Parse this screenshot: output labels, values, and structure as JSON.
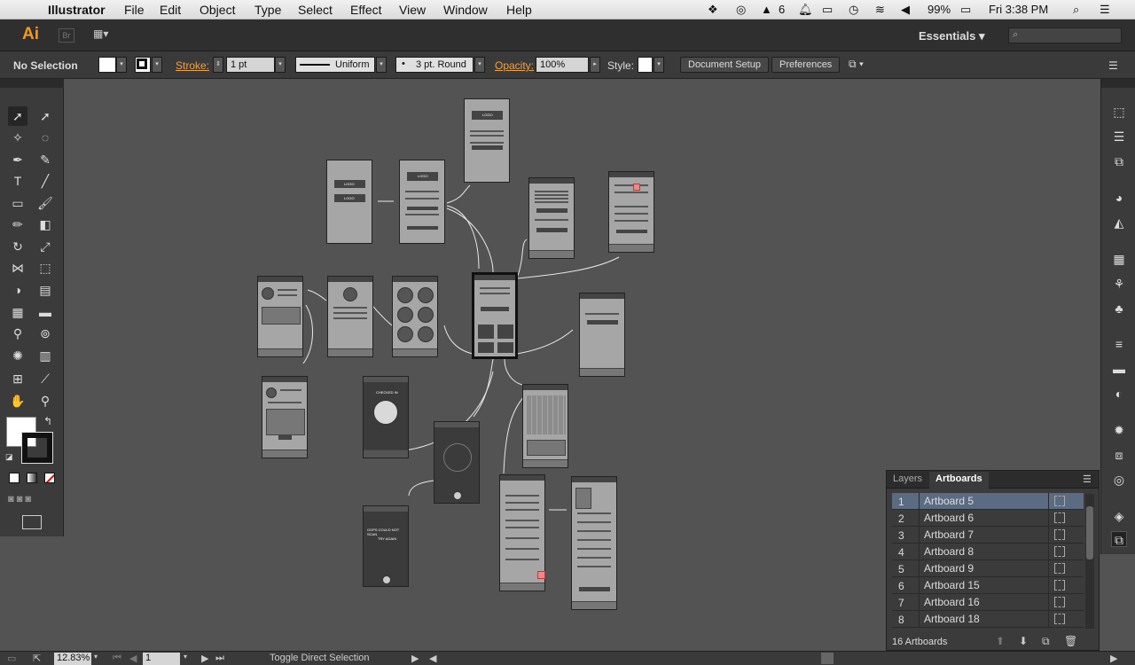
{
  "menubar": {
    "app": "Illustrator",
    "items": [
      "File",
      "Edit",
      "Object",
      "Type",
      "Select",
      "Effect",
      "View",
      "Window",
      "Help"
    ],
    "status": {
      "badge": "6",
      "battery": "99%",
      "clock": "Fri 3:38 PM"
    }
  },
  "appbar": {
    "logo": "Ai",
    "br": "Br",
    "workspace": "Essentials"
  },
  "control": {
    "selection": "No Selection",
    "stroke_label": "Stroke:",
    "stroke_value": "1 pt",
    "profile": "Uniform",
    "brush": "3 pt. Round",
    "opacity_label": "Opacity:",
    "opacity_value": "100%",
    "style_label": "Style:",
    "doc_setup": "Document Setup",
    "preferences": "Preferences"
  },
  "panel": {
    "tab_layers": "Layers",
    "tab_artboards": "Artboards",
    "rows": [
      {
        "num": "1",
        "name": "Artboard 5"
      },
      {
        "num": "2",
        "name": "Artboard 6"
      },
      {
        "num": "3",
        "name": "Artboard 7"
      },
      {
        "num": "4",
        "name": "Artboard 8"
      },
      {
        "num": "5",
        "name": "Artboard 9"
      },
      {
        "num": "6",
        "name": "Artboard 15"
      },
      {
        "num": "7",
        "name": "Artboard 16"
      },
      {
        "num": "8",
        "name": "Artboard 18"
      }
    ],
    "count": "16 Artboards"
  },
  "status": {
    "zoom": "12.83%",
    "artboard": "1",
    "tool": "Toggle Direct Selection"
  },
  "artboard_text": {
    "logo": "LOGO",
    "checked_in": "CHECKED IN",
    "oops": "OOPS COULD NOT SCAN",
    "try_again": "TRY AGAIN"
  },
  "colors": {
    "accent": "#f7981d",
    "label_orange": "#f0a24a",
    "selection": "#5a6b82"
  }
}
